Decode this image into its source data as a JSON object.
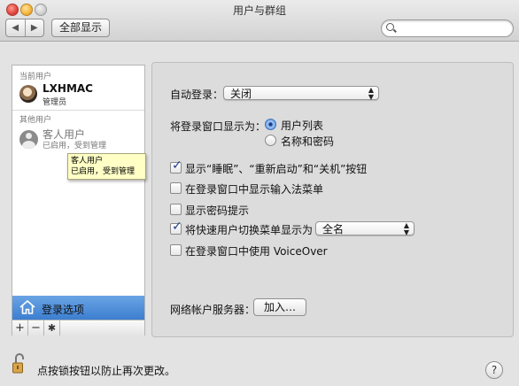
{
  "window": {
    "title": "用户与群组"
  },
  "toolbar": {
    "back_glyph": "◀",
    "forward_glyph": "▶",
    "show_all_label": "全部显示",
    "search_placeholder": ""
  },
  "sidebar": {
    "current_users_header": "当前用户",
    "current_user": {
      "name": "LXHMAC",
      "role": "管理员"
    },
    "other_users_header": "其他用户",
    "guest_user": {
      "name": "客人用户",
      "status": "已启用，受到管理"
    },
    "tooltip": {
      "line1": "客人用户",
      "line2": "已启用，受到管理"
    },
    "login_options_label": "登录选项",
    "add_glyph": "+",
    "remove_glyph": "−",
    "gear_glyph": "✱"
  },
  "pane": {
    "auto_login_label": "自动登录：",
    "auto_login_value": "关闭",
    "display_window_label": "将登录窗口显示为：",
    "radio_options": [
      {
        "label": "用户列表",
        "selected": true
      },
      {
        "label": "名称和密码",
        "selected": false
      }
    ],
    "checkboxes": [
      {
        "label": "显示“睡眠”、“重新启动”和“关机”按钮",
        "checked": true
      },
      {
        "label": "在登录窗口中显示输入法菜单",
        "checked": false
      },
      {
        "label": "显示密码提示",
        "checked": false
      },
      {
        "label": "将快速用户切换菜单显示为",
        "checked": true
      },
      {
        "label": "在登录窗口中使用 VoiceOver",
        "checked": false
      }
    ],
    "fast_switch_value": "全名",
    "network_server_label": "网络帐户服务器：",
    "join_button_label": "加入…"
  },
  "footer": {
    "lock_text": "点按锁按钮以防止再次更改。",
    "help_glyph": "?"
  },
  "colors": {
    "selection_blue": "#3c7ed0",
    "checkmark": "#1c3f91",
    "tooltip_bg": "#ffffc6"
  }
}
